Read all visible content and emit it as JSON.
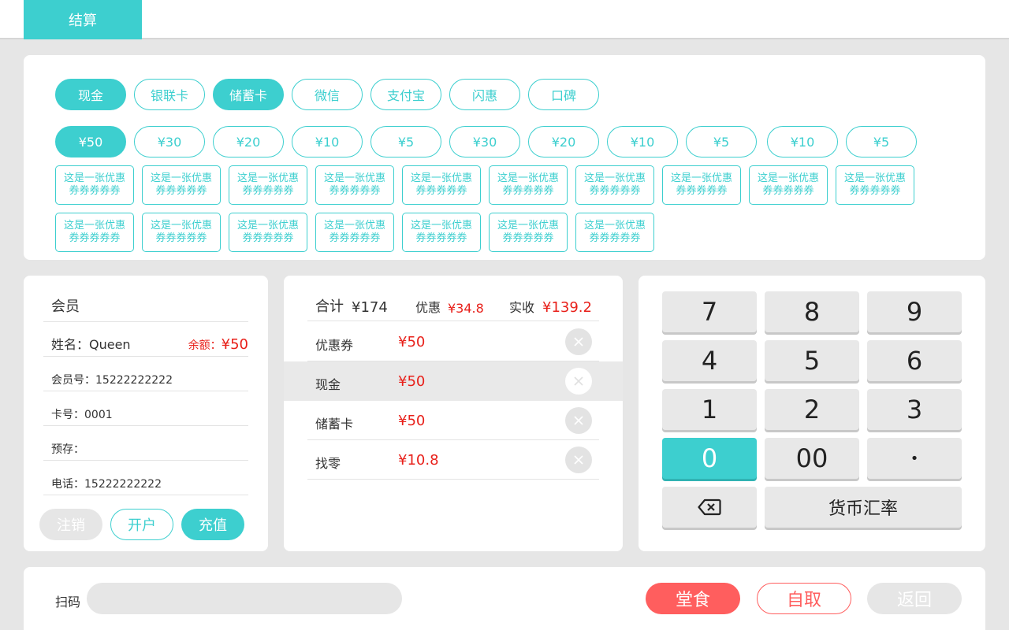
{
  "header": {
    "tab": "结算"
  },
  "payment": {
    "methods": [
      {
        "label": "现金",
        "active": true
      },
      {
        "label": "银联卡",
        "active": false
      },
      {
        "label": "储蓄卡",
        "active": true
      },
      {
        "label": "微信",
        "active": false
      },
      {
        "label": "支付宝",
        "active": false
      },
      {
        "label": "闪惠",
        "active": false
      },
      {
        "label": "口碑",
        "active": false
      }
    ],
    "amounts": [
      {
        "label": "¥50",
        "active": true
      },
      {
        "label": "¥30",
        "active": false
      },
      {
        "label": "¥20",
        "active": false
      },
      {
        "label": "¥10",
        "active": false
      },
      {
        "label": "¥5",
        "active": false
      },
      {
        "label": "¥30",
        "active": false
      },
      {
        "label": "¥20",
        "active": false
      },
      {
        "label": "¥10",
        "active": false
      },
      {
        "label": "¥5",
        "active": false
      },
      {
        "label": "¥10",
        "active": false
      },
      {
        "label": "¥5",
        "active": false
      }
    ],
    "coupons_row1": [
      {
        "line1": "这是一张优惠",
        "line2": "券券券券券"
      },
      {
        "line1": "这是一张优惠",
        "line2": "券券券券券"
      },
      {
        "line1": "这是一张优惠",
        "line2": "券券券券券"
      },
      {
        "line1": "这是一张优惠",
        "line2": "券券券券券"
      },
      {
        "line1": "这是一张优惠",
        "line2": "券券券券券"
      },
      {
        "line1": "这是一张优惠",
        "line2": "券券券券券"
      },
      {
        "line1": "这是一张优惠",
        "line2": "券券券券券"
      },
      {
        "line1": "这是一张优惠",
        "line2": "券券券券券"
      },
      {
        "line1": "这是一张优惠",
        "line2": "券券券券券"
      },
      {
        "line1": "这是一张优惠",
        "line2": "券券券券券"
      }
    ],
    "coupons_row2": [
      {
        "line1": "这是一张优惠",
        "line2": "券券券券券"
      },
      {
        "line1": "这是一张优惠",
        "line2": "券券券券券"
      },
      {
        "line1": "这是一张优惠",
        "line2": "券券券券券"
      },
      {
        "line1": "这是一张优惠",
        "line2": "券券券券券"
      },
      {
        "line1": "这是一张优惠",
        "line2": "券券券券券"
      },
      {
        "line1": "这是一张优惠",
        "line2": "券券券券券"
      },
      {
        "line1": "这是一张优惠",
        "line2": "券券券券券"
      }
    ]
  },
  "member": {
    "title": "会员",
    "name": "姓名：Queen",
    "balance_label": "余额：",
    "balance_value": "¥50",
    "member_no": "会员号：15222222222",
    "card_no": "卡号：0001",
    "prepaid": "预存：",
    "phone": "电话：15222222222",
    "btn_cancel": "注销",
    "btn_open": "开户",
    "btn_recharge": "充值"
  },
  "summary": {
    "total_label": "合计",
    "total_value": "¥174",
    "discount_label": "优惠",
    "discount_value": "¥34.8",
    "paid_label": "实收",
    "paid_value": "¥139.2",
    "rows": [
      {
        "label": "优惠券",
        "value": "¥50"
      },
      {
        "label": "现金",
        "value": "¥50"
      },
      {
        "label": "储蓄卡",
        "value": "¥50"
      },
      {
        "label": "找零",
        "value": "¥10.8"
      }
    ]
  },
  "keypad": {
    "keys": [
      "7",
      "8",
      "9",
      "4",
      "5",
      "6",
      "1",
      "2",
      "3",
      "0",
      "00",
      "•"
    ],
    "exchange_label": "货币汇率"
  },
  "bottom": {
    "scan_label": "扫码",
    "scan_value": "",
    "dine_in": "堂食",
    "takeaway": "自取",
    "back": "返回"
  },
  "colors": {
    "accent": "#3dcfcf",
    "alert": "#e8201a",
    "coral": "#ff5e5e"
  }
}
